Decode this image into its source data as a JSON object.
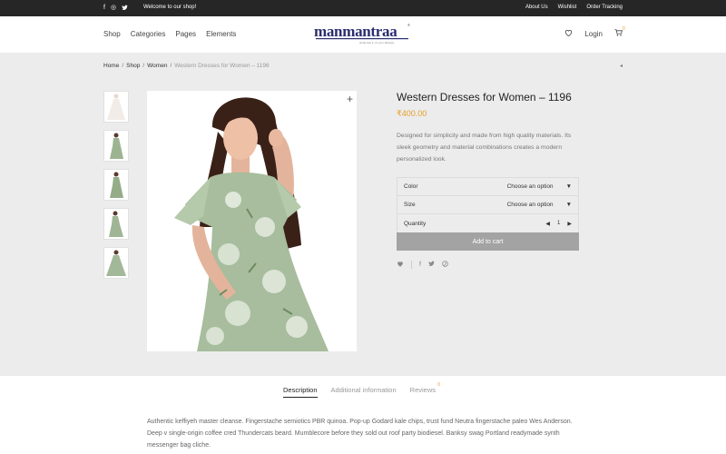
{
  "topbar": {
    "social": [
      {
        "icon": "facebook-icon",
        "glyph": "f"
      },
      {
        "icon": "instagram-icon",
        "glyph": "◎"
      },
      {
        "icon": "twitter-icon",
        "glyph": "🐦"
      }
    ],
    "welcome": "Welcome to our shop!",
    "links": [
      "About Us",
      "Wishlist",
      "Order Tracking"
    ]
  },
  "header": {
    "nav": [
      "Shop",
      "Categories",
      "Pages",
      "Elements"
    ],
    "logo": {
      "name": "manmantraa",
      "tagline": "Gotta feel it, on your lifestyle...",
      "mark": "®"
    },
    "login": "Login",
    "cart_count": "0"
  },
  "breadcrumb": {
    "items": [
      "Home",
      "Shop",
      "Women"
    ],
    "current": "Western Dresses for Women – 1196",
    "separator": "/"
  },
  "product": {
    "title": "Western Dresses for Women – 1196",
    "price": "₹400.00",
    "description": "Designed for simplicity and made from high quality materials. Its sleek geometry and material combinations creates a modern personalized look.",
    "options": {
      "color_label": "Color",
      "color_value": "Choose an option",
      "size_label": "Size",
      "size_value": "Choose an option",
      "quantity_label": "Quantity",
      "quantity_value": "1"
    },
    "add_to_cart": "Add to cart"
  },
  "tabs": {
    "description": "Description",
    "additional": "Additional information",
    "reviews": "Reviews",
    "reviews_count": "0"
  },
  "long_description": "Authentic keffiyeh master cleanse. Fingerstache semiotics PBR quinoa. Pop-up Godard kale chips, trust fund Neutra fingerstache paleo Wes Anderson. Deep v single-origin coffee cred Thundercats beard. Mumblecore before they sold out roof party biodiesel. Banksy swag Portland readymade synth messenger bag cliche.",
  "colors": {
    "accent": "#e89d2a",
    "topbar": "#262626",
    "button": "#a3a3a3",
    "logo": "#2a2d6e"
  }
}
